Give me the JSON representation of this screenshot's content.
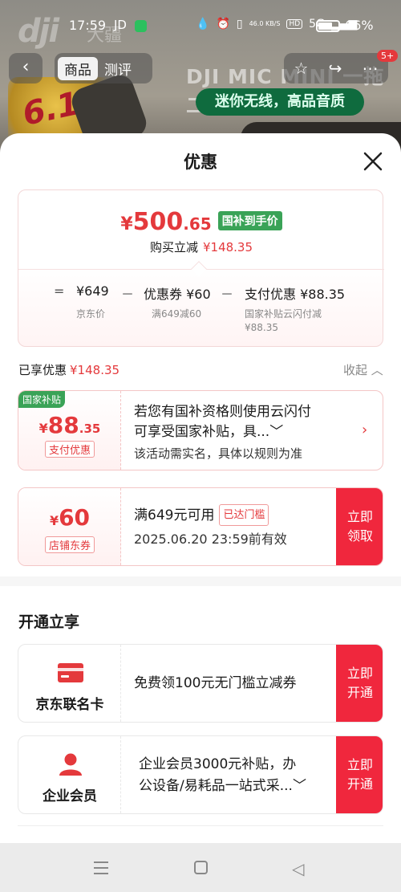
{
  "status_bar": {
    "time": "17:59",
    "carrier": "JD",
    "speed": "46.0 KB/S",
    "hd": "HD",
    "network": "5G",
    "battery": "66%"
  },
  "background": {
    "logo": "dji",
    "logo_cn": "大疆",
    "promo_text": "6.18",
    "product_title": "DJI MIC MINI 一拖二",
    "slogan": "迷你无线，高品音质"
  },
  "nav": {
    "back_icon": "chevron-left-icon",
    "tabs": [
      {
        "label": "商品",
        "active": true
      },
      {
        "label": "测评",
        "active": false
      }
    ],
    "badge": "5+"
  },
  "sheet": {
    "title": "优惠",
    "close_icon": "close-icon"
  },
  "price_card": {
    "yen": "¥",
    "price_int": "500",
    "price_dec": ".65",
    "tag": "国补到手价",
    "reduce_label": "购买立减",
    "reduce_amount": "¥148.35",
    "equation": {
      "eq": "=",
      "jd_price": "¥649",
      "jd_price_label": "京东价",
      "minus1": "－",
      "coupon": "优惠券 ¥60",
      "coupon_label": "满649减60",
      "minus2": "－",
      "payment": "支付优惠 ¥88.35",
      "payment_label": "国家补贴云闪付减",
      "payment_label2": "¥88.35"
    }
  },
  "enjoyed": {
    "label": "已享优惠",
    "amount": "¥148.35",
    "collapse": "收起 ︿"
  },
  "coupons": [
    {
      "tag": "国家补贴",
      "yen": "¥",
      "int": "88",
      "dec": ".35",
      "sub": "支付优惠",
      "line1": "若您有国补资格则使用云闪付",
      "line2": "可享受国家补贴，具...﹀",
      "note": "该活动需实名，具体以规则为准",
      "arrow": "›"
    },
    {
      "yen": "¥",
      "int": "60",
      "sub": "店铺东券",
      "line1": "满649元可用",
      "reached": "已达门槛",
      "note": "2025.06.20 23:59前有效",
      "btn_line1": "立即",
      "btn_line2": "领取"
    }
  ],
  "section": {
    "title": "开通立享"
  },
  "members": [
    {
      "icon": "credit-card-icon",
      "label": "京东联名卡",
      "text": "免费领100元无门槛立减券",
      "btn_line1": "立即",
      "btn_line2": "开通"
    },
    {
      "icon": "person-icon",
      "label": "企业会员",
      "line1": "企业会员3000元补贴，办",
      "line2": "公设备/易耗品一站式采...﹀",
      "btn_line1": "立即",
      "btn_line2": "开通"
    }
  ],
  "colors": {
    "accent_red": "#e4393c",
    "button_red": "#f0273d",
    "subsidy_green": "#3aa357"
  }
}
